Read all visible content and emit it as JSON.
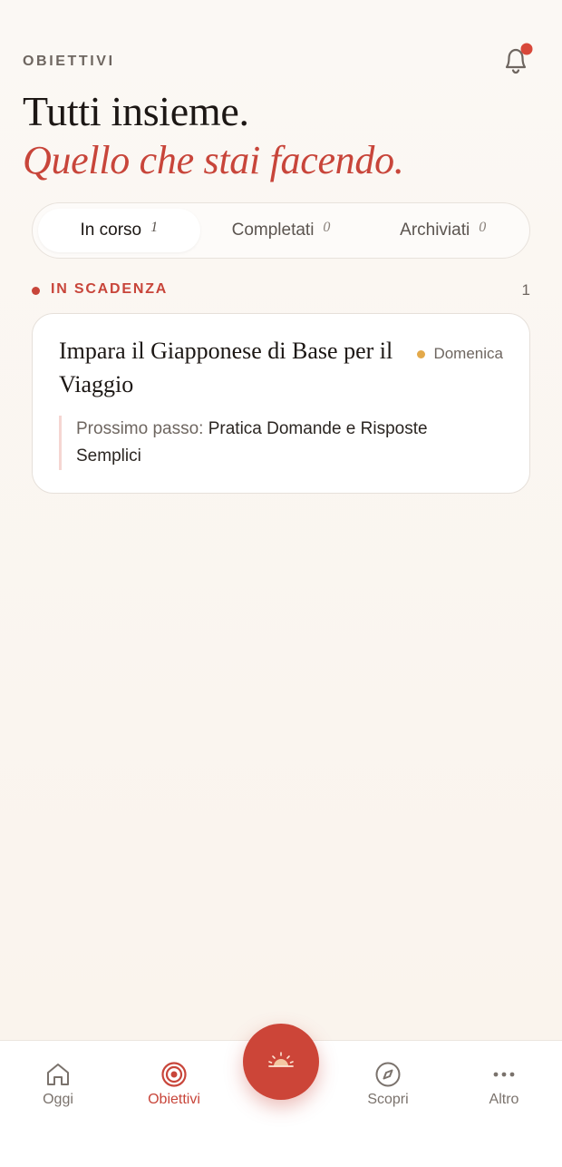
{
  "header": {
    "section_label": "OBIETTIVI",
    "title_line1": "Tutti insieme.",
    "title_line2": "Quello che stai facendo."
  },
  "tabs": [
    {
      "label": "In corso",
      "count": "1",
      "active": true
    },
    {
      "label": "Completati",
      "count": "0",
      "active": false
    },
    {
      "label": "Archiviati",
      "count": "0",
      "active": false
    }
  ],
  "due_section": {
    "label": "IN SCADENZA",
    "count": "1"
  },
  "goal_card": {
    "title": "Impara il Giapponese di Base per il Viaggio",
    "day": "Domenica",
    "next_step_prefix": "Prossimo passo:",
    "next_step_text": "Pratica Domande e Risposte Semplici"
  },
  "nav": {
    "items": [
      {
        "label": "Oggi",
        "icon": "home-icon"
      },
      {
        "label": "Obiettivi",
        "icon": "target-icon",
        "active": true
      },
      {
        "label": "Scopri",
        "icon": "compass-icon"
      },
      {
        "label": "Altro",
        "icon": "more-icon"
      }
    ],
    "fab_icon": "sunrise-icon"
  },
  "colors": {
    "accent": "#c8453a",
    "background": "#fbf8f4",
    "due_dot": "#e3a94a"
  }
}
